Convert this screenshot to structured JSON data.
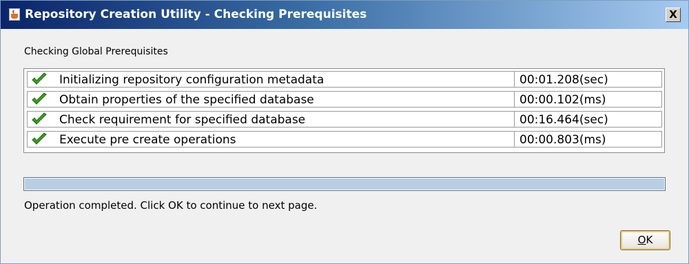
{
  "window": {
    "title": "Repository Creation Utility - Checking Prerequisites",
    "app_icon": "java-icon",
    "close_label": "X"
  },
  "section": {
    "label": "Checking Global Prerequisites"
  },
  "checks": [
    {
      "status_icon": "check-icon",
      "name": "Initializing repository configuration metadata",
      "time": "00:01.208(sec)"
    },
    {
      "status_icon": "check-icon",
      "name": "Obtain properties of the specified database",
      "time": "00:00.102(ms)"
    },
    {
      "status_icon": "check-icon",
      "name": "Check requirement for specified database",
      "time": "00:16.464(sec)"
    },
    {
      "status_icon": "check-icon",
      "name": "Execute pre create operations",
      "time": "00:00.803(ms)"
    }
  ],
  "progress": {
    "fraction": 1.0
  },
  "status": {
    "text": "Operation completed. Click OK to continue to next page."
  },
  "buttons": {
    "ok_mnemonic": "O",
    "ok_rest": "K"
  },
  "colors": {
    "title_start": "#0a246a",
    "title_end": "#a6caf0",
    "check_green": "#3aa01e",
    "progress_fill": "#b8cfe3"
  }
}
